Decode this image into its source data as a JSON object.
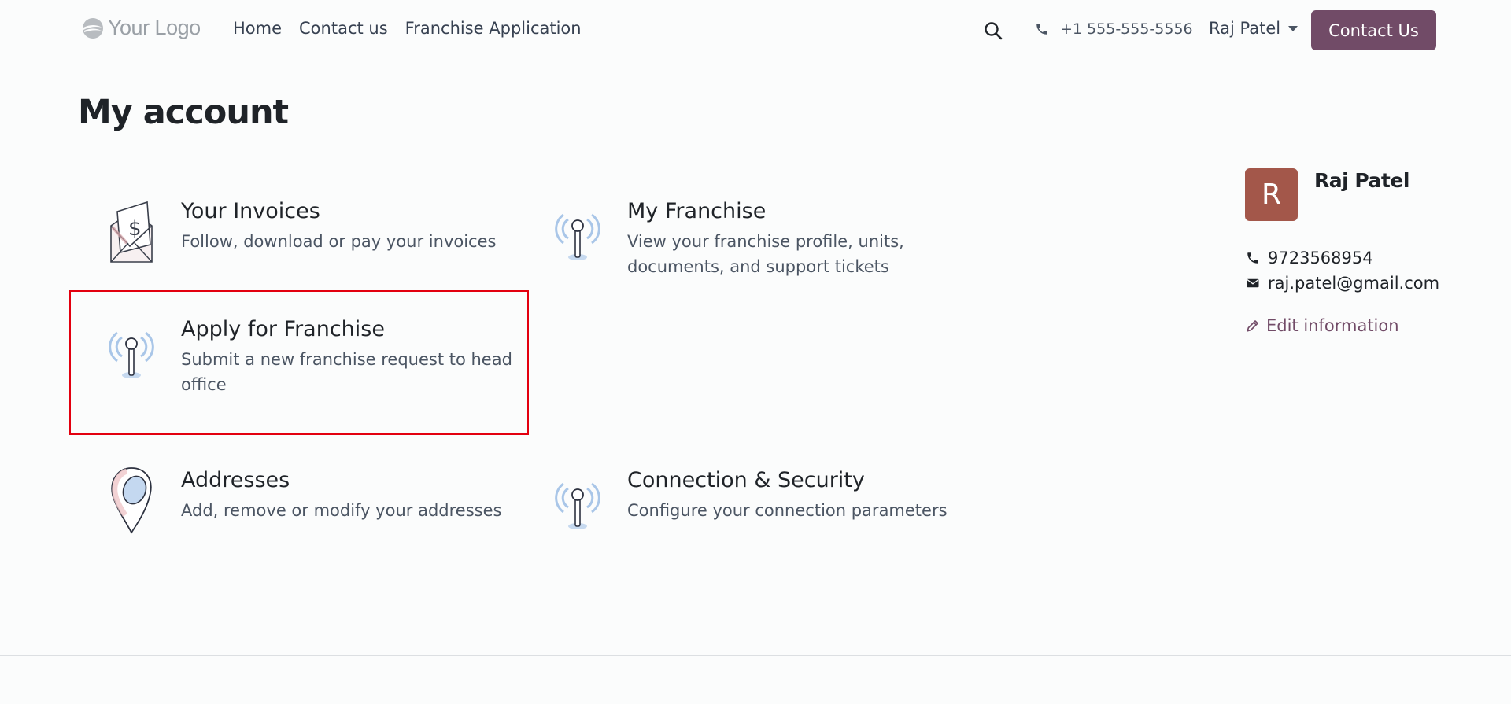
{
  "header": {
    "logo_text": "Your Logo",
    "nav": [
      "Home",
      "Contact us",
      "Franchise Application"
    ],
    "phone": "+1 555-555-5556",
    "user_name": "Raj Patel",
    "cta_label": "Contact Us"
  },
  "main": {
    "page_title": "My account",
    "cards": [
      {
        "title": "Your Invoices",
        "desc": "Follow, download or pay your invoices",
        "icon": "invoice-envelope-icon"
      },
      {
        "title": "My Franchise",
        "desc": "View your franchise profile, units, documents, and support tickets",
        "icon": "signal-tower-icon"
      },
      {
        "title": "Apply for Franchise",
        "desc": "Submit a new franchise request to head office",
        "icon": "signal-tower-icon"
      },
      {
        "title": "Addresses",
        "desc": "Add, remove or modify your addresses",
        "icon": "map-pin-icon"
      },
      {
        "title": "Connection & Security",
        "desc": "Configure your connection parameters",
        "icon": "signal-tower-icon"
      }
    ]
  },
  "profile": {
    "avatar_letter": "R",
    "name": "Raj Patel",
    "phone": "9723568954",
    "email": "raj.patel@gmail.com",
    "edit_label": "Edit information"
  },
  "colors": {
    "brand": "#714b67",
    "avatar": "#a3574a",
    "highlight": "#e3000f"
  }
}
